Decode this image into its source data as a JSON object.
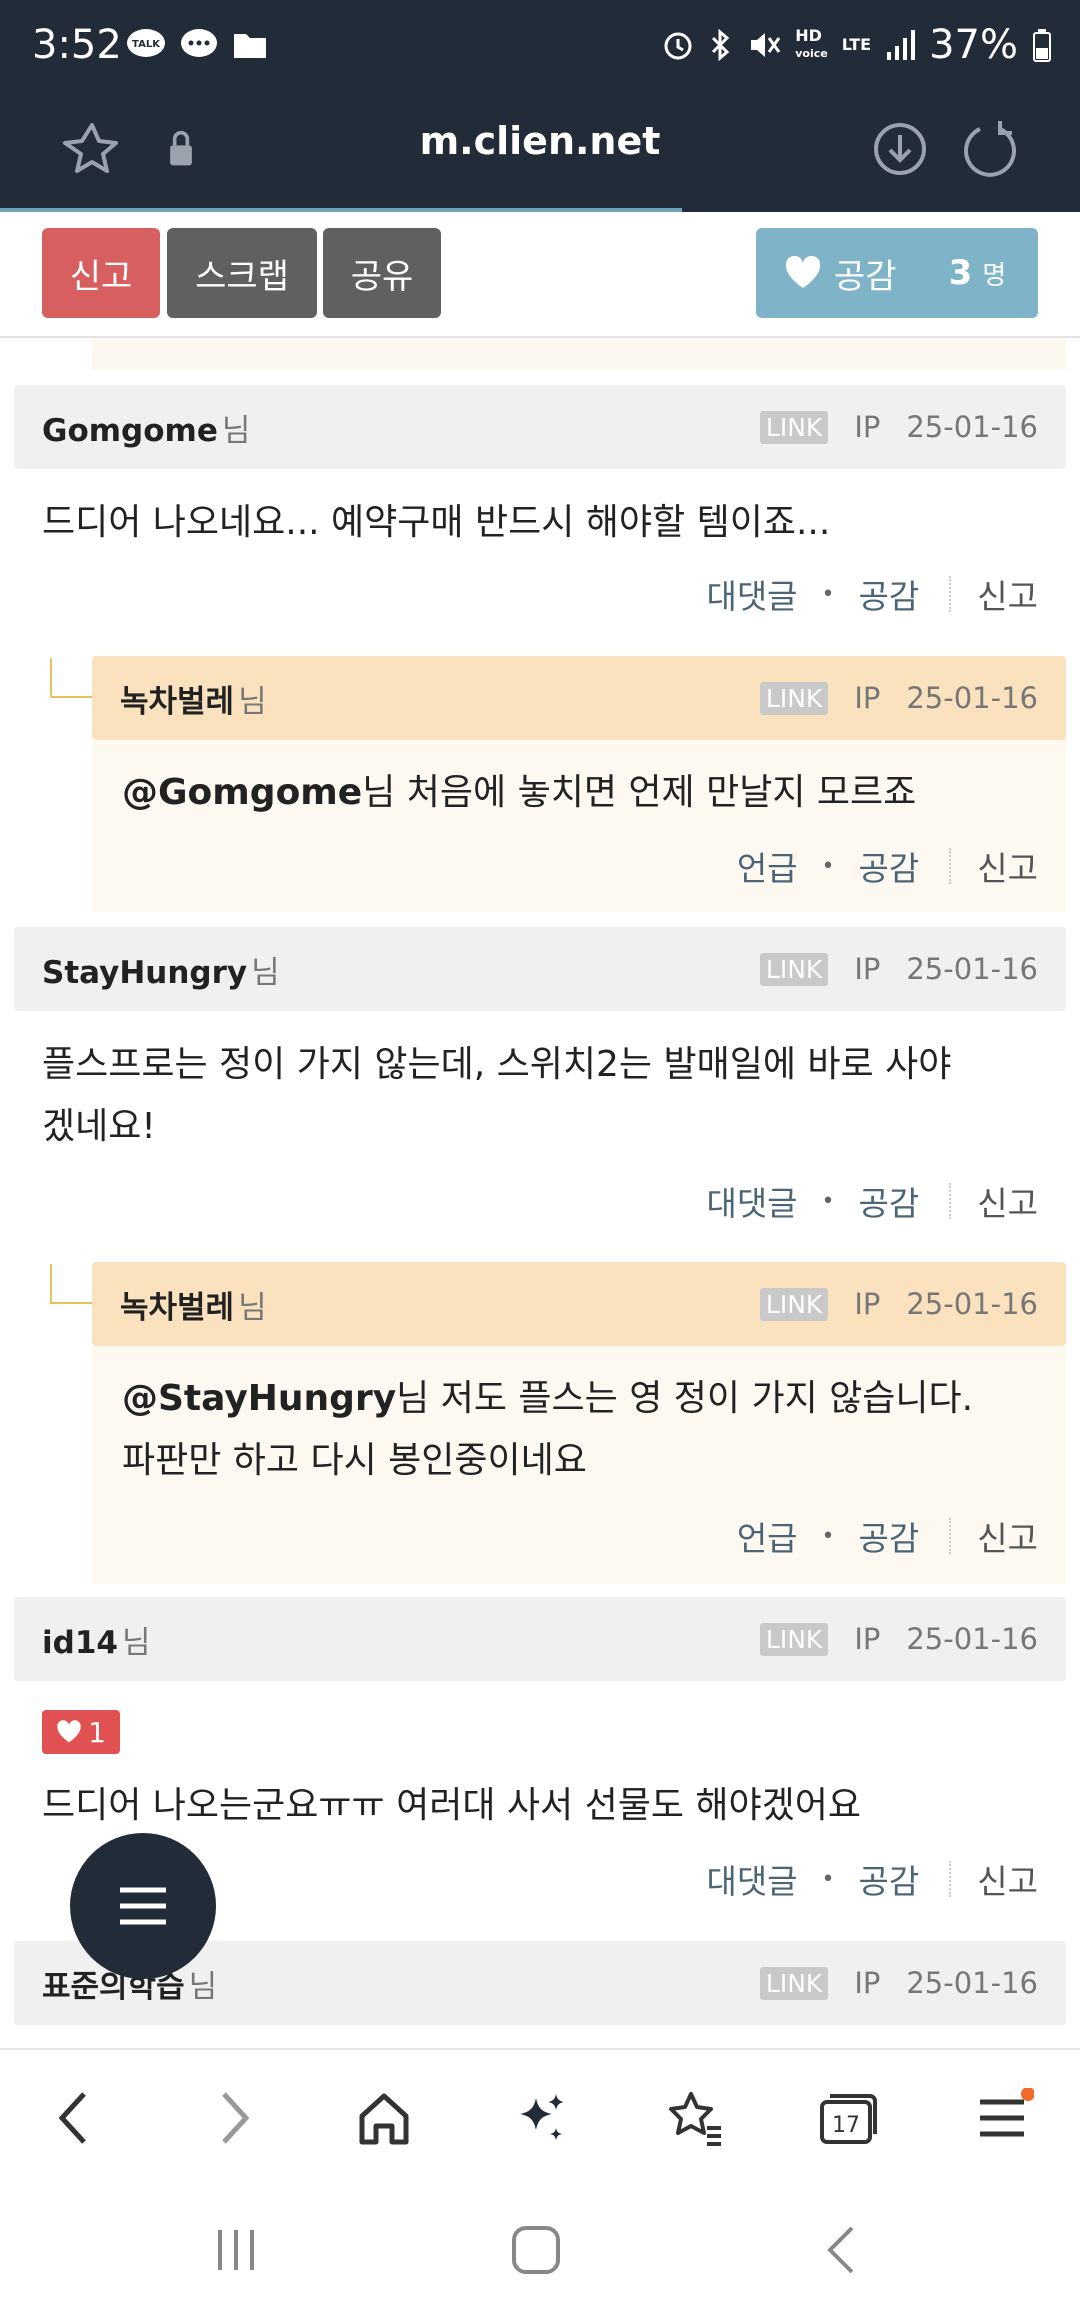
{
  "status": {
    "time": "3:52",
    "battery": "37%",
    "hd": "HD",
    "voice": "voice",
    "lte": "LTE",
    "talk": "TALK"
  },
  "browser": {
    "url": "m.clien.net"
  },
  "toolbar": {
    "report": "신고",
    "scrap": "스크랩",
    "share": "공유",
    "like": "공감",
    "like_count": "3",
    "like_unit": "명"
  },
  "comments": [
    {
      "author": "Gomgome",
      "suffix": "님",
      "link": "LINK",
      "ip": "IP",
      "date": "25-01-16",
      "text": "드디어 나오네요... 예약구매 반드시 해야할 템이죠...",
      "actions": {
        "reply": "대댓글",
        "like": "공감",
        "report": "신고"
      }
    },
    {
      "author": "녹차벌레",
      "suffix": "님",
      "link": "LINK",
      "ip": "IP",
      "date": "25-01-16",
      "mention": "@Gomgome",
      "text": "님 처음에 놓치면 언제 만날지 모르죠",
      "actions": {
        "reply": "언급",
        "like": "공감",
        "report": "신고"
      }
    },
    {
      "author": "StayHungry",
      "suffix": "님",
      "link": "LINK",
      "ip": "IP",
      "date": "25-01-16",
      "line1": "플스프로는 정이 가지 않는데, 스위치2는 발매일에 바로 사야",
      "line2": "겠네요!",
      "actions": {
        "reply": "대댓글",
        "like": "공감",
        "report": "신고"
      }
    },
    {
      "author": "녹차벌레",
      "suffix": "님",
      "link": "LINK",
      "ip": "IP",
      "date": "25-01-16",
      "mention": "@StayHungry",
      "line1": "님 저도 플스는 영 정이 가지 않습니다.",
      "line2": "파판만 하고 다시 봉인중이네요",
      "actions": {
        "reply": "언급",
        "like": "공감",
        "report": "신고"
      }
    },
    {
      "author": "id14",
      "suffix": "님",
      "link": "LINK",
      "ip": "IP",
      "date": "25-01-16",
      "likes": "1",
      "text": "드디어 나오는군요ㅠㅠ 여러대 사서 선물도 해야겠어요",
      "actions": {
        "reply": "대댓글",
        "like": "공감",
        "report": "신고"
      }
    },
    {
      "author": "표준의학습",
      "suffix": "님",
      "link": "LINK",
      "ip": "IP",
      "date": "25-01-16"
    }
  ],
  "bottom": {
    "tabs_count": "17"
  },
  "colors": {
    "header": "#222b38",
    "report": "#d85f5f",
    "gray_button": "#606060",
    "like_button": "#7fb4c8",
    "reply_head": "#fbe2bf",
    "reply_body": "#fdf9f1"
  },
  "icons": [
    "star-icon",
    "lock-icon",
    "download-icon",
    "reload-icon",
    "heart-icon",
    "menu-icon",
    "back-icon",
    "forward-icon",
    "home-icon",
    "sparkle-icon",
    "bookmarks-icon",
    "tabs-icon",
    "browser-menu-icon",
    "recent-apps-icon",
    "home-nav-icon",
    "back-nav-icon"
  ]
}
